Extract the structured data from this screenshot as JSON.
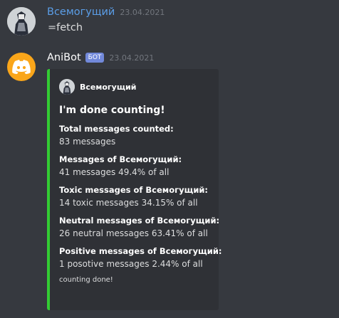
{
  "messages": [
    {
      "author": "Всемогущий",
      "timestamp": "23.04.2021",
      "content": "=fetch"
    },
    {
      "author": "AniBot",
      "bot_tag": "БОТ",
      "timestamp": "23.04.2021",
      "embed": {
        "color": "#33cc33",
        "author_name": "Всемогущий",
        "title": "I'm done counting!",
        "fields": [
          {
            "name": "Total messages counted:",
            "value": "83 messages"
          },
          {
            "name": "Messages of Всемогущий:",
            "value": "41 messages 49.4% of all"
          },
          {
            "name": "Toxic messages of Всемогущий:",
            "value": "14 toxic messages 34.15% of all"
          },
          {
            "name": "Neutral messages of Всемогущий:",
            "value": "26 neutral messages 63.41% of all"
          },
          {
            "name": "Positive messages of Всемогущий:",
            "value": "1 posotive messages 2.44% of all"
          }
        ],
        "footer": "counting done!"
      }
    }
  ],
  "icons": {
    "user_avatar": "user-avatar",
    "bot_avatar": "discord-logo-icon",
    "embed_author_icon": "user-avatar"
  },
  "colors": {
    "background": "#36393f",
    "embed_background": "#2f3136",
    "username_user": "#5b9ee8",
    "bot_avatar_bg": "#faa61a",
    "bot_tag_bg": "#7289da",
    "embed_accent": "#33cc33"
  }
}
